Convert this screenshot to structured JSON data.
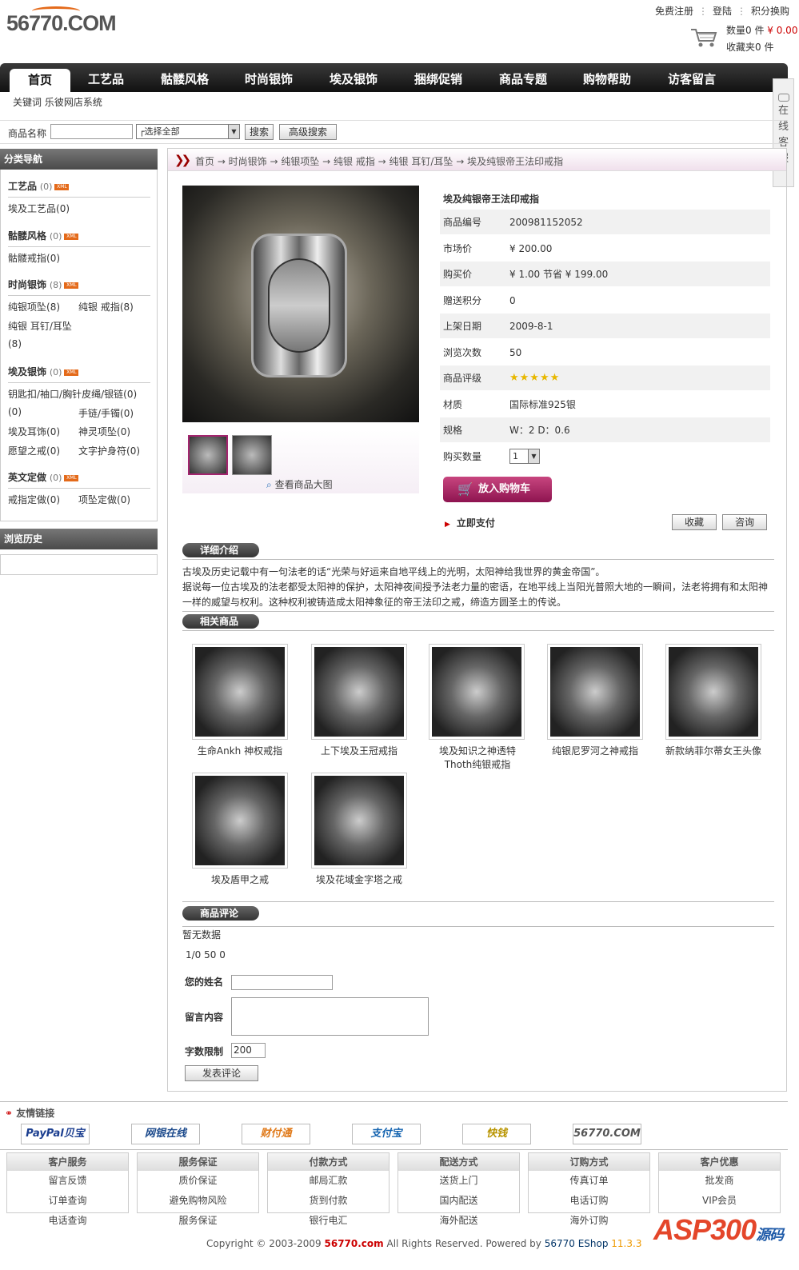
{
  "site": {
    "logo_text": "56770.COM"
  },
  "toplinks": [
    "免费注册",
    "登陆",
    "积分换购"
  ],
  "cart": {
    "count_label": "数量0 件",
    "amount": "¥ 0.00",
    "fav": "收藏夹0 件"
  },
  "nav": {
    "items": [
      "首页",
      "工艺品",
      "骷髅风格",
      "时尚银饰",
      "埃及银饰",
      "捆绑促销",
      "商品专题",
      "购物帮助",
      "访客留言"
    ]
  },
  "keywords": "关键词  乐彼网店系统",
  "service": "在线客服",
  "search": {
    "label": "商品名称",
    "select": "┌选择全部",
    "search_btn": "搜索",
    "adv_btn": "高级搜索"
  },
  "sidebar": {
    "title": "分类导航",
    "history_title": "浏览历史",
    "groups": [
      {
        "name": "工艺品",
        "count": "(0)",
        "items": [
          {
            "label": "埃及工艺品",
            "count": "(0)"
          }
        ]
      },
      {
        "name": "骷髅风格",
        "count": "(0)",
        "items": [
          {
            "label": "骷髅戒指",
            "count": "(0)"
          }
        ]
      },
      {
        "name": "时尚银饰",
        "count": "(8)",
        "items": [
          {
            "label": "纯银项坠",
            "count": "(8)"
          },
          {
            "label": "纯银  戒指",
            "count": "(8)"
          },
          {
            "label": "纯银  耳钉/耳坠",
            "count": "(8)"
          }
        ]
      },
      {
        "name": "埃及银饰",
        "count": "(0)",
        "items": [
          {
            "label": "钥匙扣/袖口/胸针皮绳/银链",
            "count": "(0)"
          },
          {
            "label": "",
            "count": "(0)"
          },
          {
            "label": "手链/手镯",
            "count": "(0)"
          },
          {
            "label": "埃及耳饰",
            "count": "(0)"
          },
          {
            "label": "神灵项坠",
            "count": "(0)"
          },
          {
            "label": "愿望之戒",
            "count": "(0)"
          },
          {
            "label": "文字护身符",
            "count": "(0)"
          }
        ]
      },
      {
        "name": "英文定做",
        "count": "(0)",
        "items": [
          {
            "label": "戒指定做",
            "count": "(0)"
          },
          {
            "label": "项坠定做",
            "count": "(0)"
          }
        ]
      }
    ],
    "xml": "XML"
  },
  "breadcrumb": "首页  → 时尚银饰  → 纯银项坠  → 纯银  戒指  → 纯银  耳钉/耳坠  → 埃及纯银帝王法印戒指",
  "product": {
    "title": "埃及纯银帝王法印戒指",
    "rows": [
      {
        "k": "商品编号",
        "v": "200981152052"
      },
      {
        "k": "市场价",
        "v": "¥ 200.00"
      },
      {
        "k": "购买价",
        "v": "¥ 1.00  节省 ¥ 199.00"
      },
      {
        "k": "赠送积分",
        "v": "0"
      },
      {
        "k": "上架日期",
        "v": "2009-8-1"
      },
      {
        "k": "浏览次数",
        "v": "50"
      },
      {
        "k": "商品评级",
        "v": "★★★★★"
      },
      {
        "k": "材质",
        "v": "国际标准925银"
      },
      {
        "k": "规格",
        "v": "W：2 D：0.6"
      },
      {
        "k": "购买数量",
        "v": ""
      }
    ],
    "qty": "1",
    "buy_btn": "放入购物车",
    "pay_now": "立即支付",
    "fav_btn": "收藏",
    "ask_btn": "咨询",
    "zoom": "查看商品大图",
    "rating": 4.5
  },
  "detail": {
    "tab": "详细介绍",
    "text": [
      "古埃及历史记载中有一句法老的话“光荣与好运来自地平线上的光明，太阳神给我世界的黄金帝国”。",
      "据说每一位古埃及的法老都受太阳神的保护，太阳神夜间授予法老力量的密语，在地平线上当阳光普照大地的一瞬间，法老将拥有和太阳神一样的威望与权利。这种权利被铸造成太阳神象征的帝王法印之戒，缔造方圆圣土的传说。"
    ]
  },
  "related": {
    "tab": "相关商品",
    "items": [
      "生命Ankh 神权戒指",
      "上下埃及王冠戒指",
      "埃及知识之神透特Thoth纯银戒指",
      "纯银尼罗河之神戒指",
      "新款纳菲尔蒂女王头像",
      "埃及盾甲之戒",
      "埃及花域金字塔之戒"
    ]
  },
  "review": {
    "tab": "商品评论",
    "empty": "暂无数据",
    "pager": "1/0    50    0",
    "name_label": "您的姓名",
    "content_label": "留言内容",
    "limit_label": "字数限制",
    "limit_value": "200",
    "submit": "发表评论"
  },
  "friends": {
    "title": "友情链接",
    "logos": [
      "PayPal贝宝",
      "网银在线",
      "财付通",
      "支付宝",
      "快钱",
      "56770.COM"
    ]
  },
  "footer": [
    {
      "h": "客户服务",
      "l": [
        "留言反馈",
        "订单查询",
        "电话查询"
      ]
    },
    {
      "h": "服务保证",
      "l": [
        "质价保证",
        "避免购物风险",
        "服务保证"
      ]
    },
    {
      "h": "付款方式",
      "l": [
        "邮局汇款",
        "货到付款",
        "银行电汇"
      ]
    },
    {
      "h": "配送方式",
      "l": [
        "送货上门",
        "国内配送",
        "海外配送"
      ]
    },
    {
      "h": "订购方式",
      "l": [
        "传真订单",
        "电话订购",
        "海外订购"
      ]
    },
    {
      "h": "客户优惠",
      "l": [
        "批发商",
        "VIP会员",
        ""
      ]
    }
  ],
  "copyright": {
    "pre": "Copyright © 2003-2009 ",
    "brand": "56770.com",
    "mid": " All Rights Reserved.  Powered by ",
    "eshop": "56770 EShop ",
    "ver": "11.3.3"
  },
  "watermark": {
    "a": "ASP300",
    "b": "源码"
  }
}
